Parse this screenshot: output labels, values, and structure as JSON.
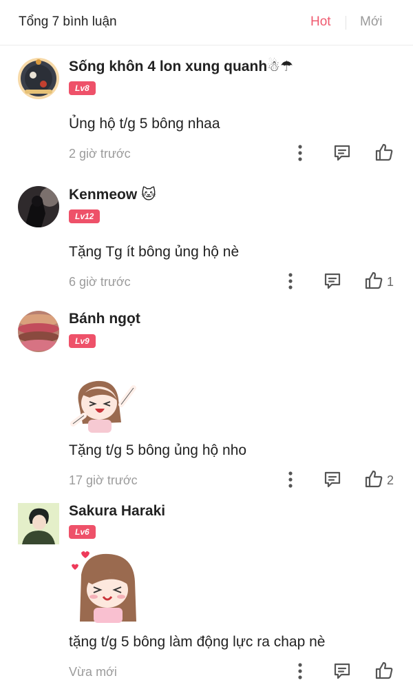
{
  "header": {
    "total": "Tổng 7 bình luận",
    "tab_hot": "Hot",
    "tab_new": "Mới"
  },
  "comments": [
    {
      "name": "Sống khôn 4 lon xung quanh☃☂",
      "level": "Lv8",
      "text": "Ủng hộ t/g 5 bông nhaa",
      "time": "2 giờ trước",
      "likes": ""
    },
    {
      "name": "Kenmeow 🐱",
      "level": "Lv12",
      "text": "Tặng Tg ít bông ủng hộ nè",
      "time": "6 giờ trước",
      "likes": "1"
    },
    {
      "name": "Bánh ngọt",
      "level": "Lv9",
      "text": "Tặng t/g 5 bông ủng hộ nho",
      "time": "17 giờ trước",
      "likes": "2"
    },
    {
      "name": "Sakura Haraki",
      "level": "Lv6",
      "text": "tặng t/g 5 bông làm động lực ra chap nè",
      "time": "Vừa mới",
      "likes": ""
    }
  ],
  "colors": {
    "accent": "#ef5a6f",
    "level_badge": "#ee5169",
    "muted": "#9b9b9b"
  },
  "icons": {
    "more": "more-vertical-icon",
    "reply": "reply-comment-icon",
    "like": "thumbs-up-icon"
  }
}
